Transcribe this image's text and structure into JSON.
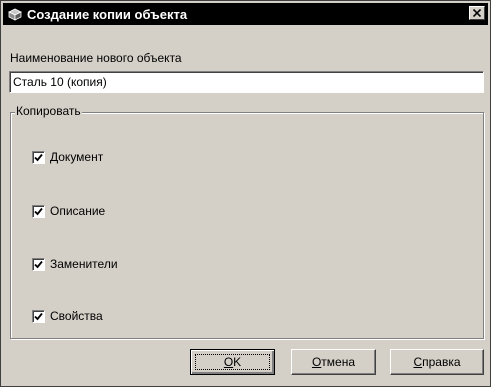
{
  "dialog": {
    "title": "Создание копии объекта",
    "close_symbol": "✕"
  },
  "name_field": {
    "label": "Наименование нового объекта",
    "value": "Сталь 10 (копия)"
  },
  "copy_group": {
    "legend": "Копировать",
    "options": [
      {
        "label": "Документ",
        "checked": true
      },
      {
        "label": "Описание",
        "checked": true
      },
      {
        "label": "Заменители",
        "checked": true
      },
      {
        "label": "Свойства",
        "checked": true
      }
    ]
  },
  "buttons": {
    "ok": "OK",
    "cancel": "Отмена",
    "help": "Справка"
  },
  "icons": {
    "title": "copy-object-icon",
    "close": "close-icon",
    "check": "checkmark-icon"
  }
}
